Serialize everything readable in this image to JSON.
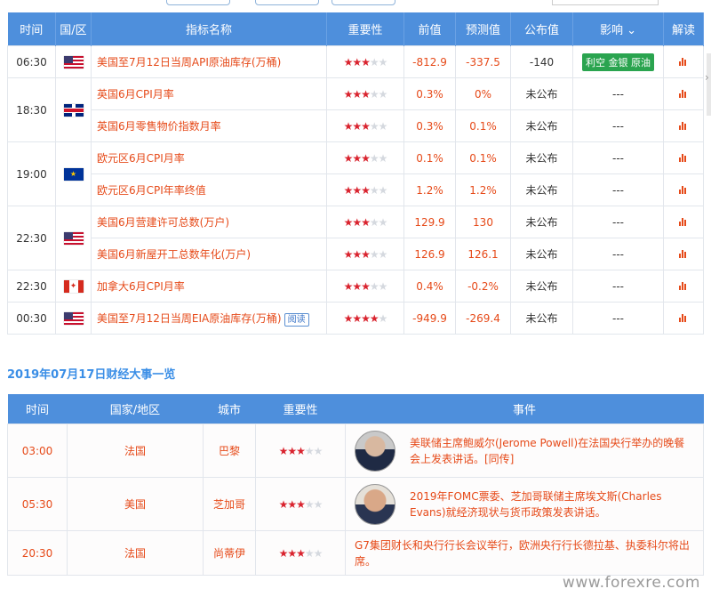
{
  "calendar": {
    "headers": [
      "时间",
      "国/区",
      "指标名称",
      "重要性",
      "前值",
      "预测值",
      "公布值",
      "影响 ⌄",
      "解读"
    ],
    "rows": [
      {
        "time": "06:30",
        "flag": "us-flag-icon",
        "name": "美国至7月12日当周API原油库存(万桶)",
        "stars": 3,
        "prev": "-812.9",
        "forecast": "-337.5",
        "actual": "-140",
        "impact": "利空 金银 原油",
        "impact_type": "tag",
        "badge": ""
      },
      {
        "time": "18:30",
        "flag": "uk-flag-icon",
        "name": "英国6月CPI月率",
        "stars": 3,
        "prev": "0.3%",
        "forecast": "0%",
        "actual": "未公布",
        "impact": "---",
        "impact_type": "text",
        "badge": ""
      },
      {
        "time": "",
        "flag": "",
        "name": "英国6月零售物价指数月率",
        "stars": 3,
        "prev": "0.3%",
        "forecast": "0.1%",
        "actual": "未公布",
        "impact": "---",
        "impact_type": "text",
        "badge": ""
      },
      {
        "time": "19:00",
        "flag": "eu-flag-icon",
        "name": "欧元区6月CPI月率",
        "stars": 3,
        "prev": "0.1%",
        "forecast": "0.1%",
        "actual": "未公布",
        "impact": "---",
        "impact_type": "text",
        "badge": ""
      },
      {
        "time": "",
        "flag": "",
        "name": "欧元区6月CPI年率终值",
        "stars": 3,
        "prev": "1.2%",
        "forecast": "1.2%",
        "actual": "未公布",
        "impact": "---",
        "impact_type": "text",
        "badge": ""
      },
      {
        "time": "22:30",
        "flag": "us-flag-icon",
        "name": "美国6月营建许可总数(万户)",
        "stars": 3,
        "prev": "129.9",
        "forecast": "130",
        "actual": "未公布",
        "impact": "---",
        "impact_type": "text",
        "badge": ""
      },
      {
        "time": "",
        "flag": "",
        "name": "美国6月新屋开工总数年化(万户)",
        "stars": 3,
        "prev": "126.9",
        "forecast": "126.1",
        "actual": "未公布",
        "impact": "---",
        "impact_type": "text",
        "badge": ""
      },
      {
        "time": "22:30",
        "flag": "ca-flag-icon",
        "name": "加拿大6月CPI月率",
        "stars": 3,
        "prev": "0.4%",
        "forecast": "-0.2%",
        "actual": "未公布",
        "impact": "---",
        "impact_type": "text",
        "badge": ""
      },
      {
        "time": "00:30",
        "flag": "us-flag-icon",
        "name": "美国至7月12日当周EIA原油库存(万桶)",
        "stars": 4,
        "prev": "-949.9",
        "forecast": "-269.4",
        "actual": "未公布",
        "impact": "---",
        "impact_type": "text",
        "badge": "阅读"
      }
    ]
  },
  "events_section": {
    "title": "2019年07月17日财经大事一览",
    "headers": [
      "时间",
      "国家/地区",
      "城市",
      "重要性",
      "事件"
    ],
    "rows": [
      {
        "time": "03:00",
        "country": "法国",
        "city": "巴黎",
        "stars": 3,
        "avatar": "powell-avatar",
        "text": "美联储主席鲍威尔(Jerome Powell)在法国央行举办的晚餐会上发表讲话。[同传]"
      },
      {
        "time": "05:30",
        "country": "美国",
        "city": "芝加哥",
        "stars": 3,
        "avatar": "evans-avatar",
        "text": "2019年FOMC票委、芝加哥联储主席埃文斯(Charles Evans)就经济现状与货币政策发表讲话。"
      },
      {
        "time": "20:30",
        "country": "法国",
        "city": "尚蒂伊",
        "stars": 3,
        "avatar": "",
        "text": "G7集团财长和央行行长会议举行，欧洲央行行长德拉基、执委科尔将出席。"
      }
    ]
  },
  "watermark": "www.forexre.com",
  "colors": {
    "header_bg": "#4e8fdc",
    "accent_text": "#e64a19",
    "star_on": "#d9232e",
    "tag_bg": "#2aa44f",
    "title": "#3a8ee6"
  }
}
